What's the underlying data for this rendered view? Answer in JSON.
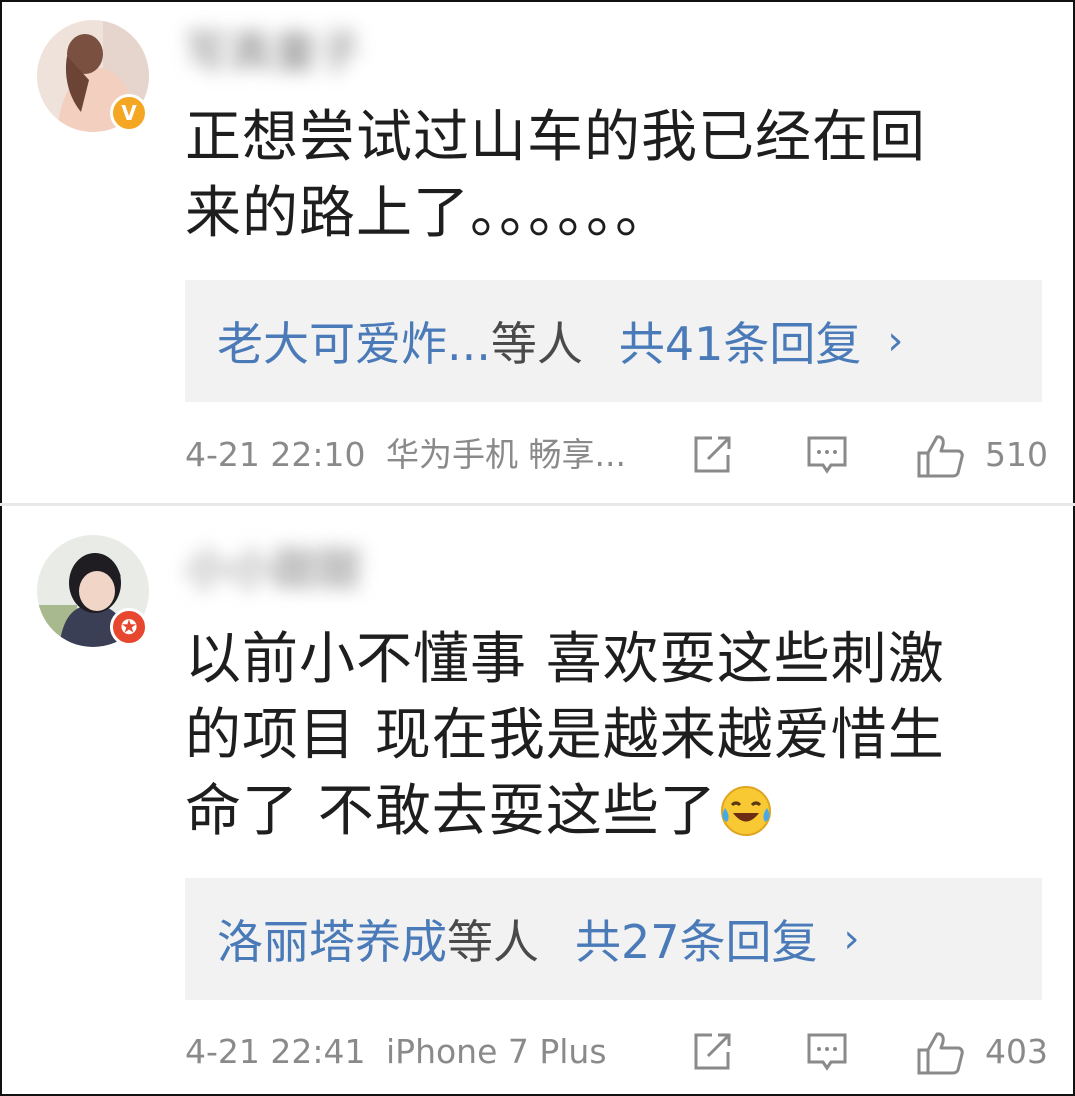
{
  "comments": [
    {
      "username": "写真童子",
      "badge": "V",
      "text_lines": [
        "正想尝试过山车的我已经在回",
        "来的路上了。。。。。。"
      ],
      "replies": {
        "names": "老大可爱炸...",
        "suffix": "等人",
        "count": "共41条回复",
        "chevron": "›"
      },
      "timestamp": "4-21 22:10",
      "source": "华为手机 畅享...",
      "likes": "510"
    },
    {
      "username": "小小甜甜",
      "badge": "✪",
      "text_lines": [
        "以前小不懂事 喜欢耍这些刺激",
        "的项目 现在我是越来越爱惜生",
        "命了 不敢去耍这些了"
      ],
      "emoji": "laughing-tears-emoji",
      "replies": {
        "names": "洛丽塔养成",
        "suffix": "等人",
        "count": "共27条回复",
        "chevron": "›"
      },
      "timestamp": "4-21 22:41",
      "source": "iPhone 7 Plus",
      "likes": "403"
    }
  ],
  "icons": {
    "share": "share-icon",
    "comment": "comment-icon",
    "like": "thumbs-up-icon"
  },
  "colors": {
    "link": "#4a7ab8",
    "meta": "#8a8a8a",
    "reply_bg": "#f2f2f2",
    "vip_badge": "#f5a623",
    "star_badge": "#e8472f"
  }
}
